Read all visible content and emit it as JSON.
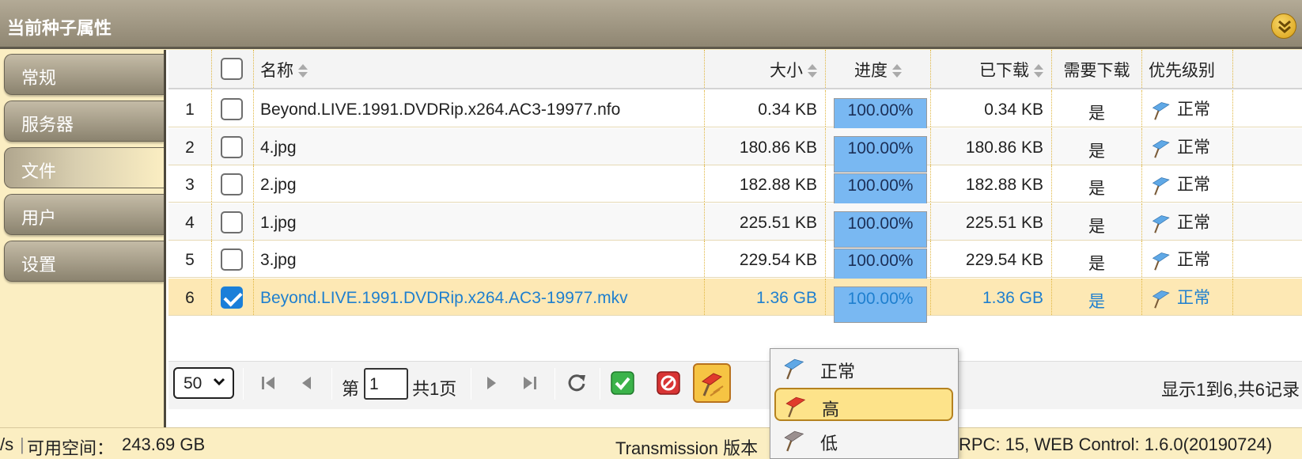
{
  "window": {
    "title": "当前种子属性"
  },
  "nav": {
    "items": [
      {
        "label": "常规",
        "active": false
      },
      {
        "label": "服务器",
        "active": false
      },
      {
        "label": "文件",
        "active": true
      },
      {
        "label": "用户",
        "active": false
      },
      {
        "label": "设置",
        "active": false
      }
    ]
  },
  "table": {
    "columns": {
      "name": "名称",
      "size": "大小",
      "progress": "进度",
      "downloaded": "已下载",
      "wanted": "需要下载",
      "priority": "优先级别"
    },
    "rows": [
      {
        "num": "1",
        "checked": false,
        "name": "Beyond.LIVE.1991.DVDRip.x264.AC3-19977.nfo",
        "size": "0.34 KB",
        "progress": "100.00%",
        "progress_value": 1.0,
        "downloaded": "0.34 KB",
        "wanted": "是",
        "priority": "正常"
      },
      {
        "num": "2",
        "checked": false,
        "name": "4.jpg",
        "size": "180.86 KB",
        "progress": "100.00%",
        "progress_value": 1.0,
        "downloaded": "180.86 KB",
        "wanted": "是",
        "priority": "正常"
      },
      {
        "num": "3",
        "checked": false,
        "name": "2.jpg",
        "size": "182.88 KB",
        "progress": "100.00%",
        "progress_value": 1.0,
        "downloaded": "182.88 KB",
        "wanted": "是",
        "priority": "正常"
      },
      {
        "num": "4",
        "checked": false,
        "name": "1.jpg",
        "size": "225.51 KB",
        "progress": "100.00%",
        "progress_value": 1.0,
        "downloaded": "225.51 KB",
        "wanted": "是",
        "priority": "正常"
      },
      {
        "num": "5",
        "checked": false,
        "name": "3.jpg",
        "size": "229.54 KB",
        "progress": "100.00%",
        "progress_value": 1.0,
        "downloaded": "229.54 KB",
        "wanted": "是",
        "priority": "正常"
      },
      {
        "num": "6",
        "checked": true,
        "name": "Beyond.LIVE.1991.DVDRip.x264.AC3-19977.mkv",
        "size": "1.36 GB",
        "progress": "100.00%",
        "progress_value": 1.0,
        "downloaded": "1.36 GB",
        "wanted": "是",
        "priority": "正常"
      }
    ]
  },
  "pager": {
    "page_size": "50",
    "page_prefix": "第",
    "current_page": "1",
    "page_suffix": "共1页",
    "records": "显示1到6,共6记录"
  },
  "priority_menu": {
    "items": [
      {
        "label": "正常",
        "icon": "flag-blue-icon"
      },
      {
        "label": "高",
        "icon": "flag-red-icon"
      },
      {
        "label": "低",
        "icon": "flag-gray-icon"
      }
    ]
  },
  "status": {
    "speed_tail": "/s",
    "divider": "|",
    "free_space_label": "可用空间：",
    "free_space_value": "243.69 GB",
    "version_label": "Transmission 版本",
    "rpc_info": "RPC: 15, WEB Control: 1.6.0(20190724)"
  },
  "colors": {
    "accent": "#1e7fcf",
    "progress": "#79b8f2",
    "selected_row": "#fde8b4",
    "background": "#fbeec2"
  }
}
